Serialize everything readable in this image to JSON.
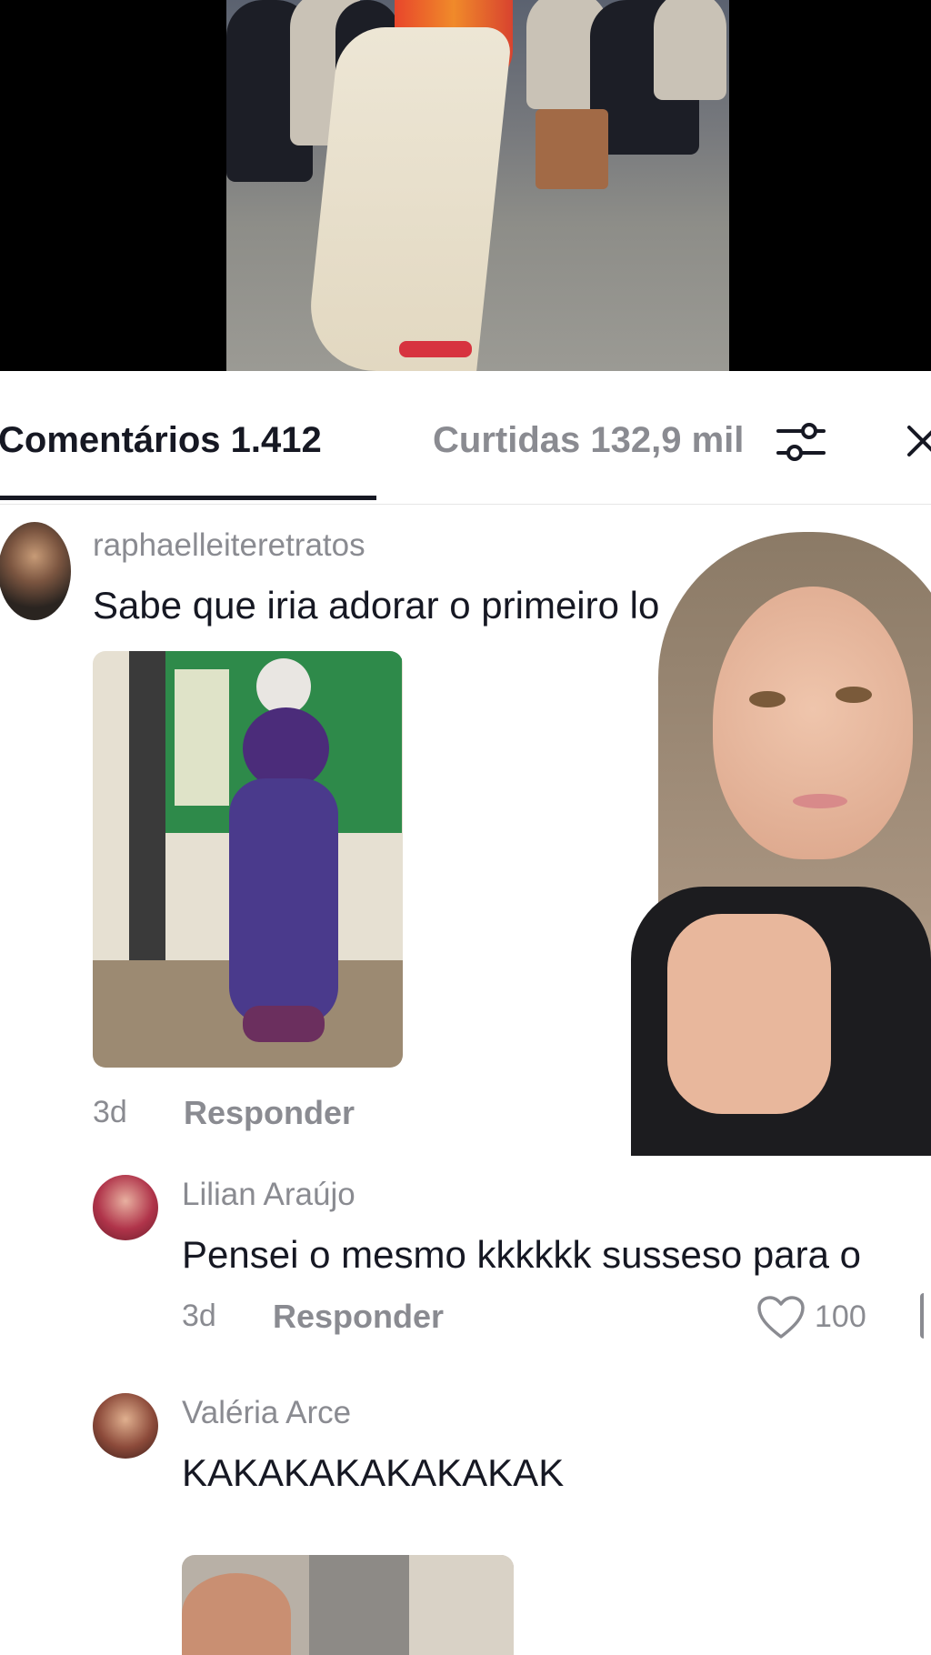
{
  "tabs": {
    "comments_label": "Comentários 1.412",
    "likes_label": "Curtidas 132,9 mil"
  },
  "comments": [
    {
      "username": "raphaelleiteretratos",
      "text": "Sabe que iria adorar o primeiro lo",
      "time": "3d",
      "reply_label": "Responder"
    },
    {
      "username": "Lilian Araújo",
      "text": "Pensei o mesmo kkkkkk susseso para o",
      "time": "3d",
      "reply_label": "Responder",
      "likes": "100"
    },
    {
      "username": "Valéria Arce",
      "text": "KAKAKAKAKAKAKAK"
    }
  ],
  "icons": {
    "filter": "sliders-icon",
    "close": "close-icon",
    "like": "heart-icon"
  },
  "colors": {
    "text_primary": "#161823",
    "text_secondary": "#8a8b91",
    "divider": "#e6e6e6"
  }
}
